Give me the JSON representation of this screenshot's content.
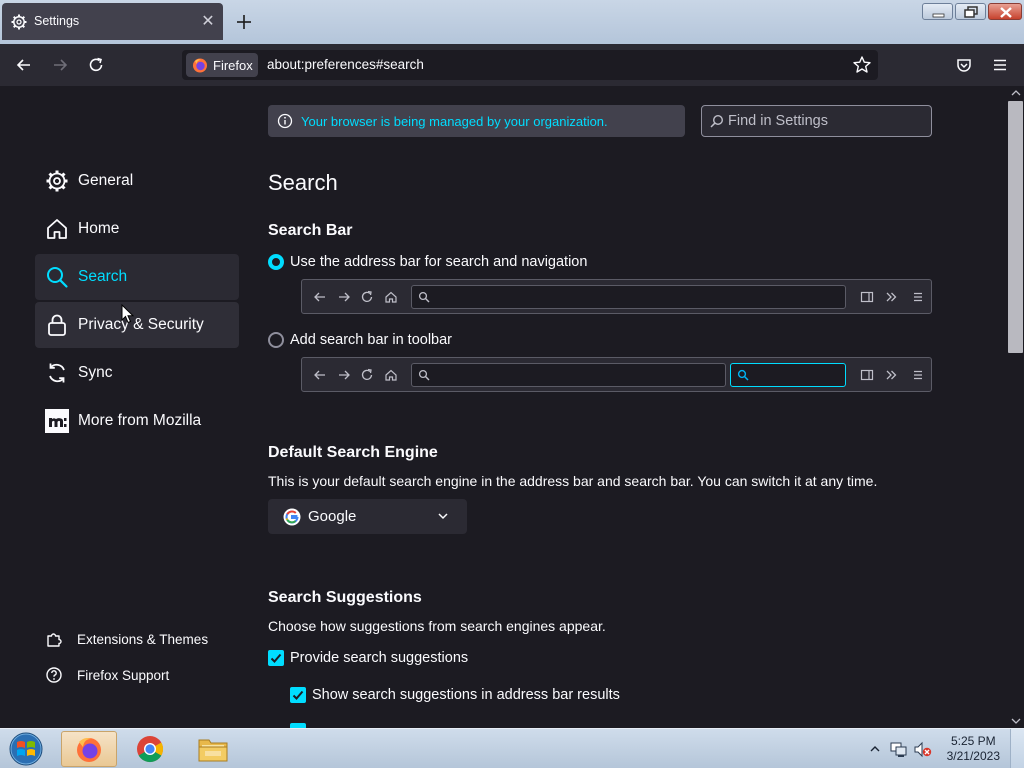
{
  "browser": {
    "tab": {
      "title": "Settings",
      "close_glyph": "✕"
    },
    "identity_label": "Firefox",
    "url": "about:preferences#search"
  },
  "sidebar": {
    "categories": [
      {
        "label": "General",
        "icon": "gear-icon",
        "state": "normal"
      },
      {
        "label": "Home",
        "icon": "home-icon",
        "state": "normal"
      },
      {
        "label": "Search",
        "icon": "search-icon",
        "state": "active"
      },
      {
        "label": "Privacy & Security",
        "icon": "lock-icon",
        "state": "hover"
      },
      {
        "label": "Sync",
        "icon": "sync-icon",
        "state": "normal"
      },
      {
        "label": "More from Mozilla",
        "icon": "mozilla-icon",
        "state": "normal"
      }
    ],
    "footer": [
      {
        "label": "Extensions & Themes",
        "icon": "puzzle-icon"
      },
      {
        "label": "Firefox Support",
        "icon": "help-icon"
      }
    ]
  },
  "main": {
    "policy_notice": "Your browser is being managed by your organization.",
    "find_placeholder": "Find in Settings",
    "page_title": "Search",
    "search_bar": {
      "heading": "Search Bar",
      "options": [
        {
          "label": "Use the address bar for search and navigation",
          "selected": true
        },
        {
          "label": "Add search bar in toolbar",
          "selected": false
        }
      ]
    },
    "default_engine": {
      "heading": "Default Search Engine",
      "description": "This is your default search engine in the address bar and search bar. You can switch it at any time.",
      "selected_engine": "Google"
    },
    "suggestions": {
      "heading": "Search Suggestions",
      "description": "Choose how suggestions from search engines appear.",
      "provide": {
        "label": "Provide search suggestions",
        "checked": true
      },
      "show_in_address_bar": {
        "label": "Show search suggestions in address bar results",
        "checked": true
      }
    }
  },
  "taskbar": {
    "apps": [
      "firefox-icon",
      "chrome-icon",
      "file-explorer-icon"
    ],
    "active_app": "firefox-icon",
    "time": "5:25 PM",
    "date": "3/21/2023"
  },
  "colors": {
    "accent": "#00ddff",
    "page_bg": "#1c1b22",
    "panel_bg": "#2b2a33"
  }
}
